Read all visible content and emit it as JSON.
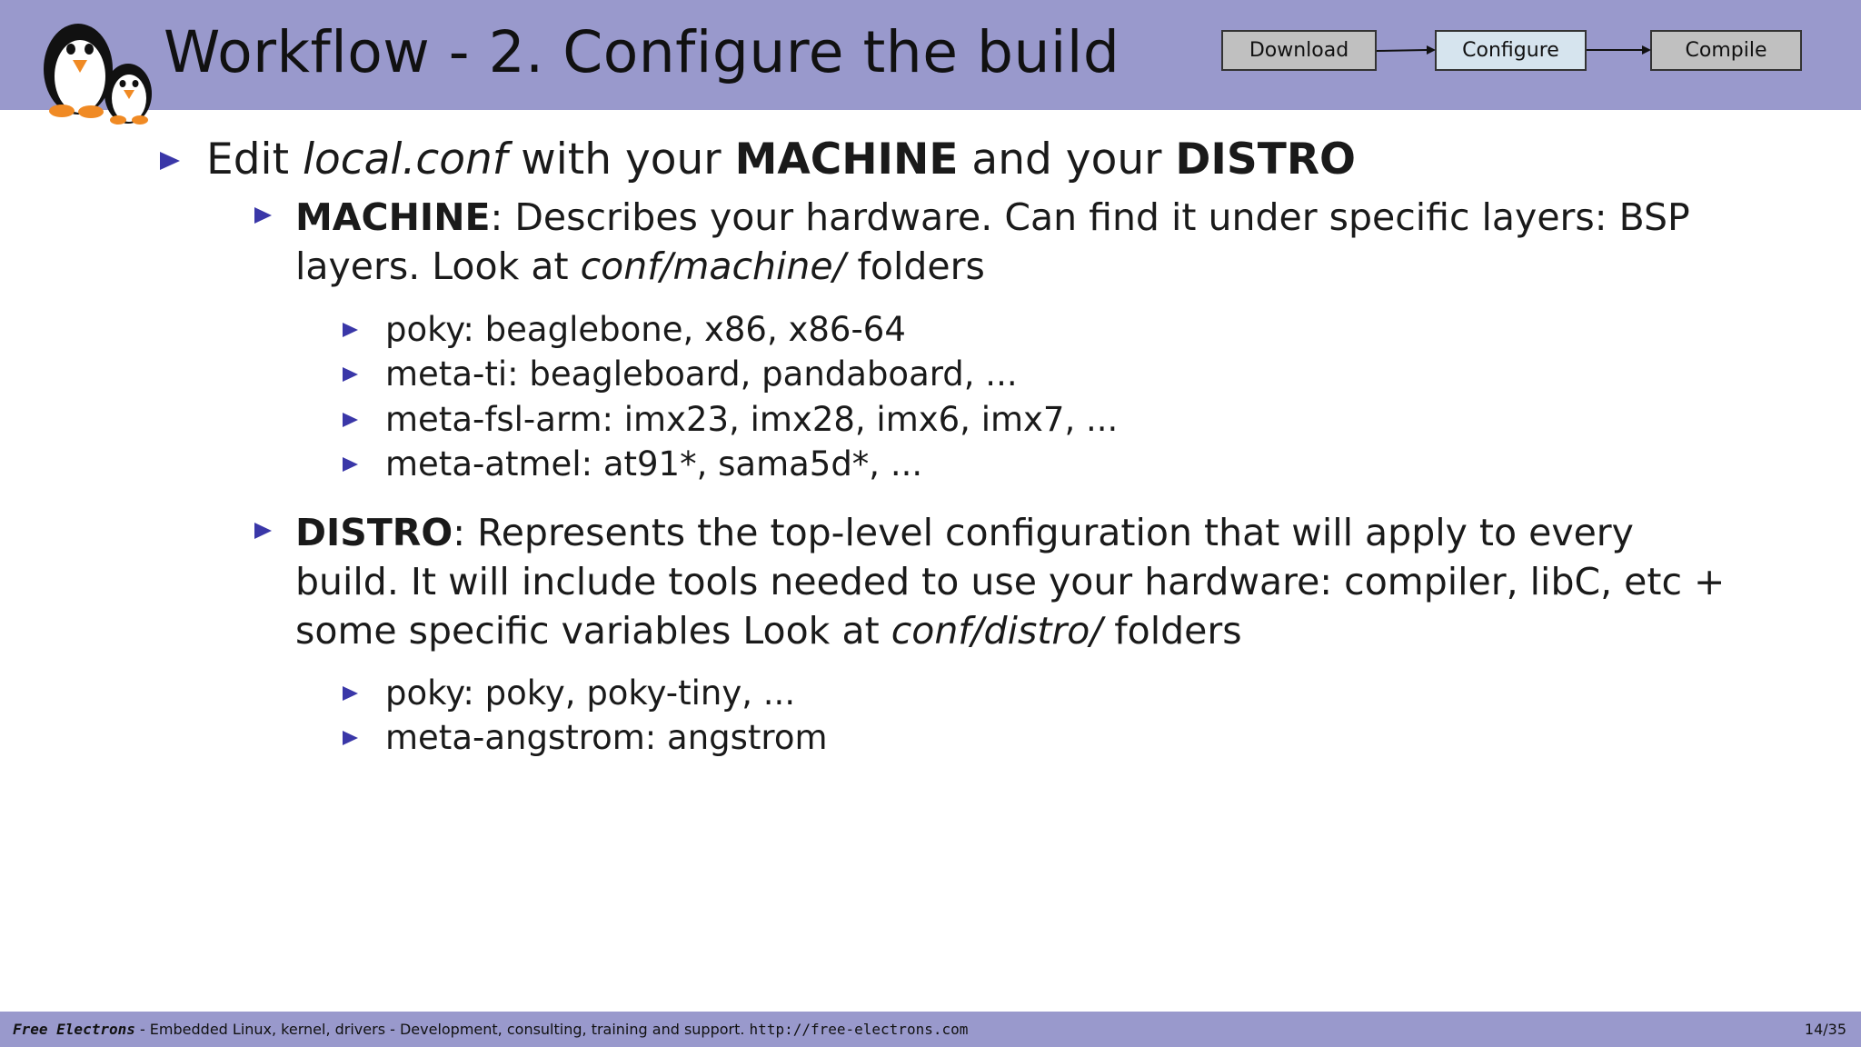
{
  "header": {
    "title": "Workflow - 2.  Configure the build",
    "workflow": [
      {
        "label": "Download",
        "state": "inactive"
      },
      {
        "label": "Configure",
        "state": "active"
      },
      {
        "label": "Compile",
        "state": "inactive"
      }
    ]
  },
  "main": {
    "bullet": {
      "pre": "Edit ",
      "file": "local.conf",
      "mid": " with your ",
      "machine": "MACHINE",
      "and": " and your ",
      "distro": "DISTRO"
    },
    "machine": {
      "term": "MACHINE",
      "desc": ": Describes your hardware.  Can find it under specific layers: BSP layers. Look at ",
      "folder": "conf/machine/",
      "post": " folders",
      "items": [
        "poky:  beaglebone, x86, x86-64",
        "meta-ti:  beagleboard, pandaboard, ...",
        "meta-fsl-arm:  imx23, imx28, imx6, imx7, ...",
        "meta-atmel:  at91*, sama5d*, ..."
      ]
    },
    "distro": {
      "term": "DISTRO",
      "desc": ": Represents the top-level configuration that will apply to every build.  It will include tools needed to use your hardware: compiler, libC, etc + some specific variables Look at ",
      "folder": "conf/distro/",
      "post": " folders",
      "items": [
        "poky:  poky, poky-tiny, ...",
        "meta-angstrom:  angstrom"
      ]
    }
  },
  "footer": {
    "brand": "Free Electrons",
    "tagline": " - Embedded Linux, kernel, drivers - Development, consulting, training and support.  ",
    "url": "http://free-electrons.com",
    "page": "14/35"
  },
  "colors": {
    "header_band": "#9999cc",
    "bullet": "#3a37a8",
    "active_step": "#d6e4ee",
    "inactive_step": "#c0c0c0"
  }
}
